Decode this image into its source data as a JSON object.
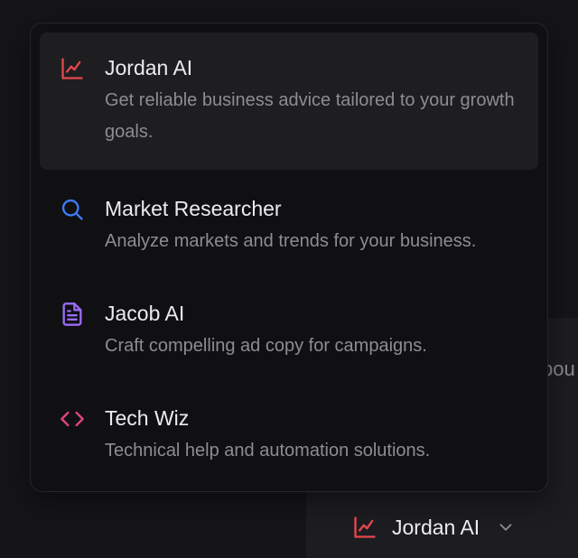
{
  "colors": {
    "chart_red": "#e5484d",
    "search_blue": "#3e7bfa",
    "doc_purple": "#9b6cf7",
    "code_pink": "#e0457b"
  },
  "menu": {
    "items": [
      {
        "title": "Jordan AI",
        "description": "Get reliable business advice tailored to your growth goals.",
        "icon": "line-chart-icon",
        "active": true
      },
      {
        "title": "Market Researcher",
        "description": "Analyze markets and trends for your business.",
        "icon": "search-icon",
        "active": false
      },
      {
        "title": "Jacob AI",
        "description": "Craft compelling ad copy for campaigns.",
        "icon": "document-icon",
        "active": false
      },
      {
        "title": "Tech Wiz",
        "description": "Technical help and automation solutions.",
        "icon": "code-icon",
        "active": false
      }
    ]
  },
  "background": {
    "partial_text": "bou"
  },
  "selector": {
    "label": "Jordan AI",
    "icon": "line-chart-icon",
    "chevron": "chevron-down-icon"
  }
}
